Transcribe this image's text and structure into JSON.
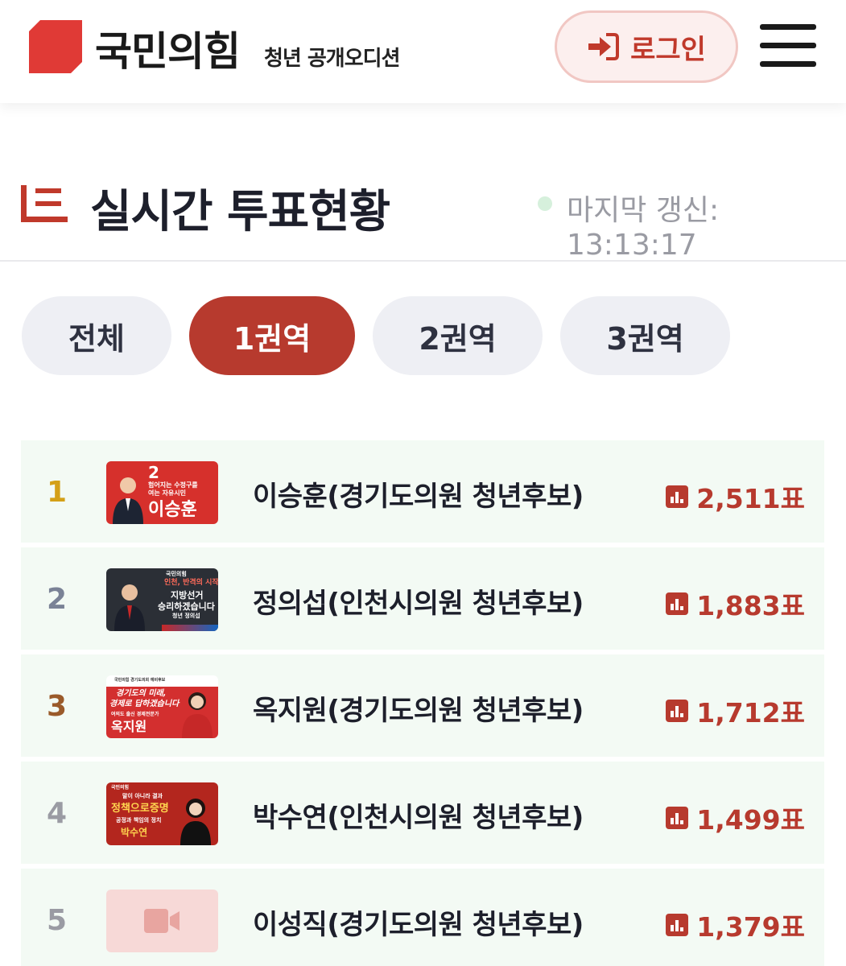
{
  "header": {
    "logo_text": "국민의힘",
    "logo_sub": "청년 공개오디션",
    "login_label": "로그인",
    "menu_icon": "hamburger-menu-icon"
  },
  "title": {
    "text": "실시간 투표현황",
    "updated_label": "마지막 갱신: 13:13:17"
  },
  "tabs": [
    {
      "label": "전체",
      "active": false
    },
    {
      "label": "1권역",
      "active": true
    },
    {
      "label": "2권역",
      "active": false
    },
    {
      "label": "3권역",
      "active": false
    }
  ],
  "candidates": [
    {
      "rank": "1",
      "name": "이승훈(경기도의원 청년후보)",
      "votes": "2,511표",
      "rank_color": "#d4a017",
      "thumb": {
        "line1": "2",
        "line2": "험어지는 수정구를",
        "line3": "여는 자유시민",
        "line4": "이승훈"
      }
    },
    {
      "rank": "2",
      "name": "정의섭(인천시의원 청년후보)",
      "votes": "1,883표",
      "rank_color": "#7a8296",
      "thumb": {
        "line1": "국민의힘",
        "line2": "인천, 반격의 시작",
        "line3": "지방선거",
        "line4": "승리하겠습니다",
        "line5": "청년 정의섭"
      }
    },
    {
      "rank": "3",
      "name": "옥지원(경기도의원 청년후보)",
      "votes": "1,712표",
      "rank_color": "#9a5a2a",
      "thumb": {
        "line1": "국민의힘 경기도의회 예비후보",
        "line2": "경기도의 미래,",
        "line3": "경제로 답하겠습니다",
        "line4": "여의도 출신 경제전문가",
        "line5": "옥지원"
      }
    },
    {
      "rank": "4",
      "name": "박수연(인천시의원 청년후보)",
      "votes": "1,499표",
      "rank_color": "#9a9ba3",
      "thumb": {
        "line1": "국민의힘",
        "line2": "말이 아니라 결과",
        "line3": "정책으로증명",
        "line4": "공정과 책임의 정치",
        "line5": "박수연"
      }
    },
    {
      "rank": "5",
      "name": "이성직(경기도의원 청년후보)",
      "votes": "1,379표",
      "rank_color": "#9a9ba3",
      "thumb": {
        "placeholder_icon": "video-camera-icon"
      }
    }
  ],
  "colors": {
    "brand": "#e03a36",
    "accent": "#b73a2e",
    "row_bg": "#f3faf4",
    "live_dot": "#d6f0dc"
  }
}
